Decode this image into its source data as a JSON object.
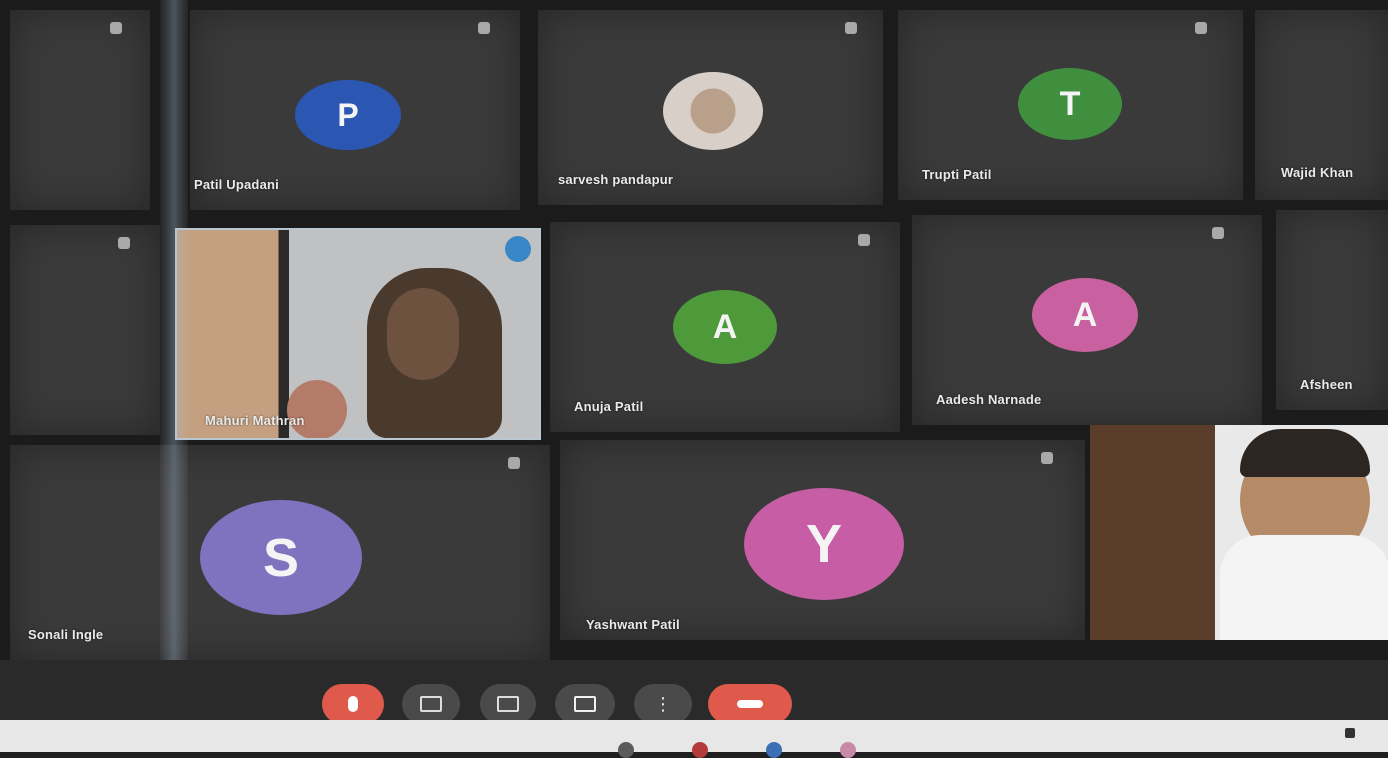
{
  "participants": [
    {
      "id": "t1",
      "name": "",
      "initial": "",
      "avatar_color": ""
    },
    {
      "id": "t2",
      "name": "Patil Upadani",
      "initial": "P",
      "avatar_color": "#2b57b3"
    },
    {
      "id": "t3",
      "name": "sarvesh pandapur",
      "initial": "",
      "avatar_color": ""
    },
    {
      "id": "t4",
      "name": "Trupti Patil",
      "initial": "T",
      "avatar_color": "#3f8f3f"
    },
    {
      "id": "t5",
      "name": "Wajid Khan",
      "initial": "",
      "avatar_color": ""
    },
    {
      "id": "t6",
      "name": "",
      "initial": "",
      "avatar_color": ""
    },
    {
      "id": "t7",
      "name": "Mahuri Mathran",
      "initial": "",
      "avatar_color": ""
    },
    {
      "id": "t8",
      "name": "Anuja Patil",
      "initial": "A",
      "avatar_color": "#4e9a3a"
    },
    {
      "id": "t9",
      "name": "Aadesh Narnade",
      "initial": "A",
      "avatar_color": "#c9609f"
    },
    {
      "id": "t10",
      "name": "Afsheen",
      "initial": "",
      "avatar_color": ""
    },
    {
      "id": "t11",
      "name": "Sonali Ingle",
      "initial": "S",
      "avatar_color": "#7f73bf"
    },
    {
      "id": "t12",
      "name": "Yashwant Patil",
      "initial": "Y",
      "avatar_color": "#c75da4"
    },
    {
      "id": "t13",
      "name": "",
      "initial": "",
      "avatar_color": ""
    }
  ],
  "controls": {
    "mic_icon": "mic-icon",
    "camera_icon": "camera-icon",
    "captions_icon": "captions-icon",
    "present_icon": "present-icon",
    "more_icon": "more-icon",
    "leave_icon": "leave-call-icon",
    "more_label": "⋮"
  }
}
